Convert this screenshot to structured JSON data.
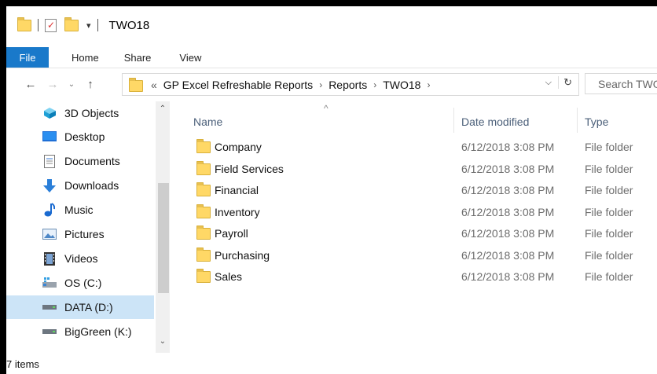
{
  "window": {
    "title": "TWO18"
  },
  "ribbon": {
    "tabs": [
      "File",
      "Home",
      "Share",
      "View"
    ]
  },
  "address": {
    "overflow": "«",
    "crumbs": [
      "GP Excel Refreshable Reports",
      "Reports",
      "TWO18"
    ],
    "search_placeholder": "Search TWO"
  },
  "sidebar": {
    "items": [
      {
        "label": "3D Objects",
        "icon": "3d-objects-icon"
      },
      {
        "label": "Desktop",
        "icon": "desktop-icon"
      },
      {
        "label": "Documents",
        "icon": "documents-icon"
      },
      {
        "label": "Downloads",
        "icon": "downloads-icon"
      },
      {
        "label": "Music",
        "icon": "music-icon"
      },
      {
        "label": "Pictures",
        "icon": "pictures-icon"
      },
      {
        "label": "Videos",
        "icon": "videos-icon"
      },
      {
        "label": "OS (C:)",
        "icon": "drive-c-icon"
      },
      {
        "label": "DATA (D:)",
        "icon": "drive-d-icon",
        "selected": true
      },
      {
        "label": "BigGreen (K:)",
        "icon": "drive-k-icon"
      }
    ]
  },
  "columns": {
    "name": "Name",
    "date": "Date modified",
    "type": "Type"
  },
  "files": [
    {
      "name": "Company",
      "date": "6/12/2018 3:08 PM",
      "type": "File folder"
    },
    {
      "name": "Field Services",
      "date": "6/12/2018 3:08 PM",
      "type": "File folder"
    },
    {
      "name": "Financial",
      "date": "6/12/2018 3:08 PM",
      "type": "File folder"
    },
    {
      "name": "Inventory",
      "date": "6/12/2018 3:08 PM",
      "type": "File folder"
    },
    {
      "name": "Payroll",
      "date": "6/12/2018 3:08 PM",
      "type": "File folder"
    },
    {
      "name": "Purchasing",
      "date": "6/12/2018 3:08 PM",
      "type": "File folder"
    },
    {
      "name": "Sales",
      "date": "6/12/2018 3:08 PM",
      "type": "File folder"
    }
  ],
  "status": {
    "count": "7 items"
  },
  "colors": {
    "file_tab": "#1979ca",
    "selected": "#cce4f7",
    "folder": "#ffd866"
  }
}
